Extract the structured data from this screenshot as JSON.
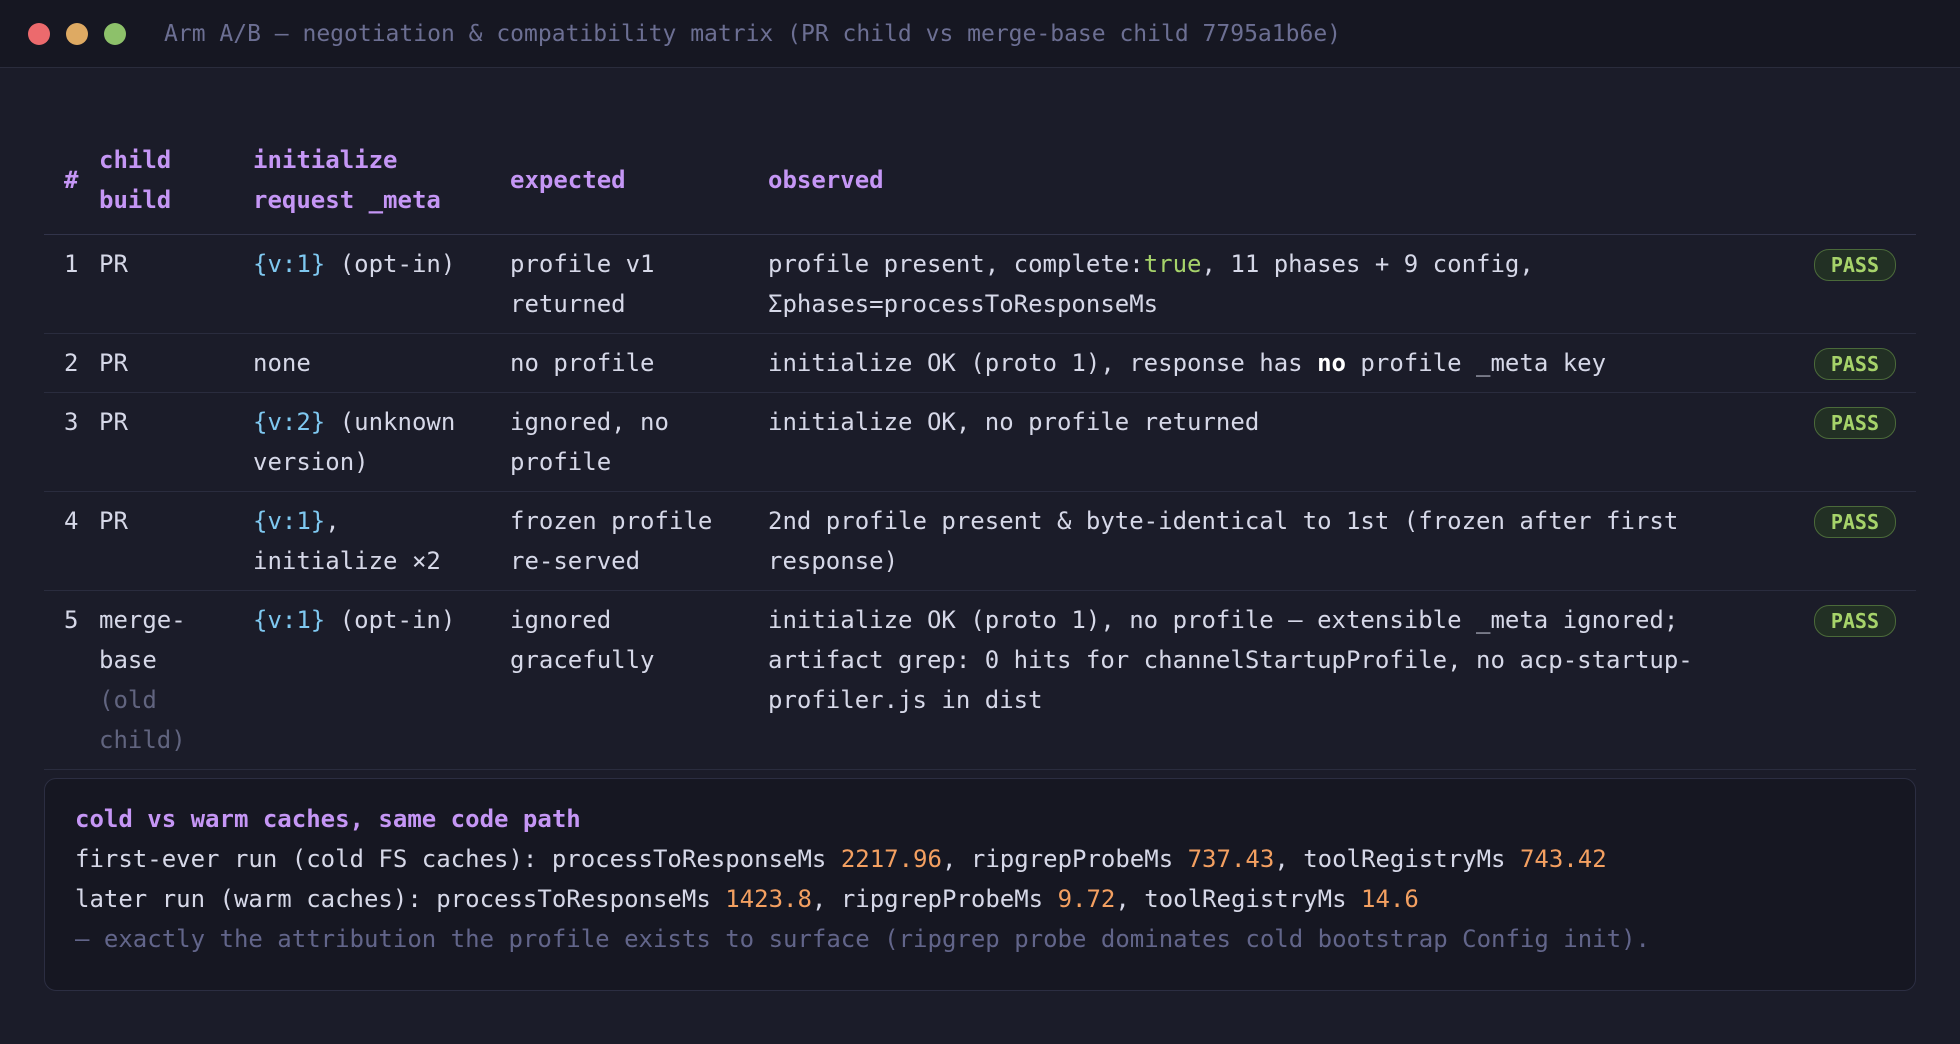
{
  "window": {
    "title": "Arm A/B — negotiation & compatibility matrix (PR child vs merge-base child 7795a1b6e)"
  },
  "table": {
    "headers": {
      "num": "#",
      "build_1": "child",
      "build_2": "build",
      "request_1": "initialize",
      "request_2": "request _meta",
      "expected": "expected",
      "observed": "observed"
    },
    "rows": [
      {
        "num": "1",
        "build": "PR",
        "req_code": "{v:1}",
        "req_text": " (opt-in)",
        "expected_1": "profile v1",
        "expected_2": "returned",
        "obs_a": "profile present, complete:",
        "obs_b": "true",
        "obs_c": ", 11 phases + 9 config,",
        "obs_d": "Σphases=processToResponseMs",
        "result": "PASS"
      },
      {
        "num": "2",
        "build": "PR",
        "req_text": "none",
        "expected_1": "no profile",
        "obs_a": "initialize OK (proto 1), response has ",
        "obs_b": "no",
        "obs_c": " profile _meta key",
        "result": "PASS"
      },
      {
        "num": "3",
        "build": "PR",
        "req_code": "{v:2}",
        "req_text": " (unknown",
        "req_text_2": "version)",
        "expected_1": "ignored, no",
        "expected_2": "profile",
        "obs_a": "initialize OK, no profile returned",
        "result": "PASS"
      },
      {
        "num": "4",
        "build": "PR",
        "req_code": "{v:1}",
        "req_text": ",",
        "req_text_2": "initialize ×2",
        "expected_1": "frozen profile",
        "expected_2": "re-served",
        "obs_a": "2nd profile present & byte-identical to 1st (frozen after first",
        "obs_b": "response)",
        "result": "PASS"
      },
      {
        "num": "5",
        "build_1": "merge-",
        "build_2": "base",
        "build_3": "(old",
        "build_4": "child)",
        "req_code": "{v:1}",
        "req_text": " (opt-in)",
        "expected_1": "ignored",
        "expected_2": "gracefully",
        "obs_a": "initialize OK (proto 1), no profile — extensible _meta ignored;",
        "obs_b": "artifact grep: 0 hits for channelStartupProfile, no acp-startup-",
        "obs_c": "profiler.js in dist",
        "result": "PASS"
      }
    ]
  },
  "note": {
    "title": "cold vs warm caches, same code path",
    "cold_label": "first-ever run (cold FS caches): processToResponseMs ",
    "cold_ptr": "2217.96",
    "cold_sep1": ", ripgrepProbeMs ",
    "cold_rg": "737.43",
    "cold_sep2": ", toolRegistryMs ",
    "cold_tool": "743.42",
    "warm_label": "later run (warm caches): processToResponseMs ",
    "warm_ptr": "1423.8",
    "warm_sep1": ", ripgrepProbeMs ",
    "warm_rg": "9.72",
    "warm_sep2": ", toolRegistryMs ",
    "warm_tool": "14.6",
    "footer": "— exactly the attribution the profile exists to surface (ripgrep probe dominates cold bootstrap Config init)."
  },
  "colors": {
    "accent": "#c596f5",
    "pass": "#a6d36a",
    "code": "#7fc8f0",
    "number": "#f4a061"
  }
}
